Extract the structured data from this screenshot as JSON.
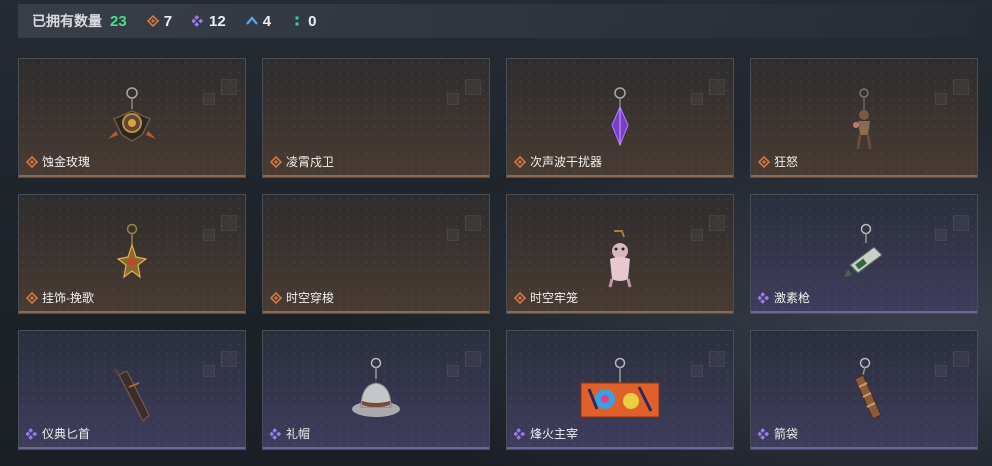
{
  "header": {
    "owned_label": "已拥有数量",
    "owned_total": "23",
    "stats": [
      {
        "icon": "orange-diamond-icon",
        "color": "#d9783c",
        "value": "7"
      },
      {
        "icon": "purple-diamond-icon",
        "color": "#9b7bf0",
        "value": "12"
      },
      {
        "icon": "blue-chevron-icon",
        "color": "#5aa8e8",
        "value": "4"
      },
      {
        "icon": "green-dots-icon",
        "color": "#3ecf9a",
        "value": "0"
      }
    ]
  },
  "items": [
    {
      "name": "蚀金玫瑰",
      "rarity": "orange",
      "art": "rose-pendant-icon"
    },
    {
      "name": "凌霄戍卫",
      "rarity": "orange",
      "art": "none"
    },
    {
      "name": "次声波干扰器",
      "rarity": "orange",
      "art": "purple-crystal-icon"
    },
    {
      "name": "狂怒",
      "rarity": "orange",
      "art": "figure-pendant-icon"
    },
    {
      "name": "挂饰-挽歌",
      "rarity": "orange",
      "art": "gold-emblem-icon"
    },
    {
      "name": "时空穿梭",
      "rarity": "orange",
      "art": "none"
    },
    {
      "name": "时空牢笼",
      "rarity": "orange",
      "art": "pink-figure-icon"
    },
    {
      "name": "激素枪",
      "rarity": "purple",
      "art": "injector-gun-icon"
    },
    {
      "name": "仪典匕首",
      "rarity": "purple",
      "art": "dagger-icon"
    },
    {
      "name": "礼帽",
      "rarity": "purple",
      "art": "fedora-hat-icon"
    },
    {
      "name": "烽火主宰",
      "rarity": "purple",
      "art": "graffiti-box-icon"
    },
    {
      "name": "箭袋",
      "rarity": "purple",
      "art": "quiver-icon"
    }
  ],
  "colors": {
    "orange": "#d9783c",
    "purple": "#9b7bf0",
    "green": "#46e08c"
  }
}
